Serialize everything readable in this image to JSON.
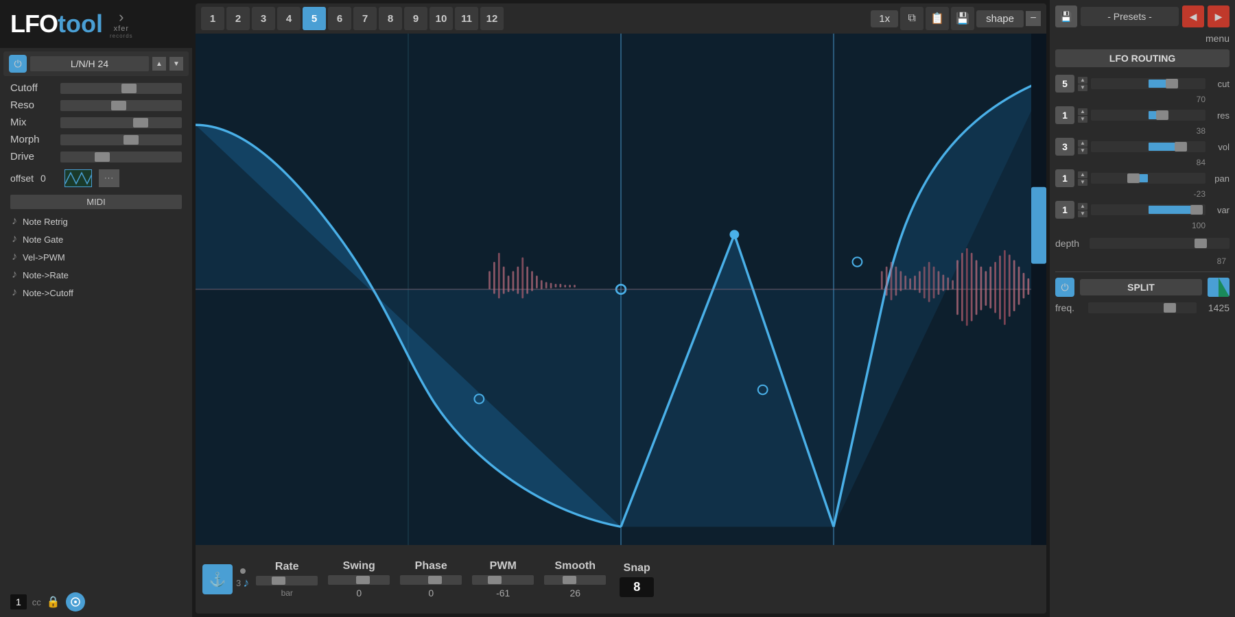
{
  "app": {
    "name_lfo": "LFO",
    "name_tool": "tool",
    "xfer_label": "xfer",
    "xfer_sub": "records"
  },
  "left_panel": {
    "filter_preset": "L/N/H 24",
    "power_icon": "⏻",
    "params": [
      {
        "label": "Cutoff",
        "thumb_pos": "55%"
      },
      {
        "label": "Reso",
        "thumb_pos": "48%"
      },
      {
        "label": "Mix",
        "thumb_pos": "65%"
      },
      {
        "label": "Morph",
        "thumb_pos": "58%"
      },
      {
        "label": "Drive",
        "thumb_pos": "35%"
      }
    ],
    "offset_label": "offset",
    "offset_value": "0",
    "midi_label": "MIDI",
    "midi_items": [
      "Note Retrig",
      "Note Gate",
      "Vel->PWM",
      "Note->Rate",
      "Note->Cutoff"
    ],
    "cc_value": "1",
    "cc_label": "cc"
  },
  "center_panel": {
    "tabs": [
      "1",
      "2",
      "3",
      "4",
      "5",
      "6",
      "7",
      "8",
      "9",
      "10",
      "11",
      "12"
    ],
    "active_tab": 5,
    "rate_display": "1x",
    "shape_label": "shape",
    "minus_label": "−",
    "bottom_bar": {
      "anchor_icon": "⚓",
      "beat_num": "3",
      "note_icon": "♪",
      "params": [
        {
          "label": "Rate",
          "value": "bar",
          "unit": "bar",
          "thumb_pos": "30%"
        },
        {
          "label": "Swing",
          "value": "0",
          "thumb_pos": "50%"
        },
        {
          "label": "Phase",
          "value": "0",
          "thumb_pos": "50%"
        },
        {
          "label": "PWM",
          "value": "-61",
          "thumb_pos": "30%"
        },
        {
          "label": "Smooth 26",
          "value": "26",
          "thumb_pos": "35%"
        }
      ],
      "snap_label": "Snap",
      "snap_value": "8"
    }
  },
  "right_panel": {
    "presets_label": "- Presets -",
    "prev_icon": "◀",
    "next_icon": "▶",
    "save_icon": "💾",
    "menu_label": "menu",
    "lfo_routing_title": "LFO ROUTING",
    "routing_rows": [
      {
        "num": "5",
        "label": "cut",
        "value": "70",
        "thumb_pos": "68%",
        "fill_width": "18%",
        "fill_left": "50%"
      },
      {
        "num": "1",
        "label": "res",
        "value": "38",
        "thumb_pos": "60%",
        "fill_width": "10%",
        "fill_left": "50%"
      },
      {
        "num": "3",
        "label": "vol",
        "value": "84",
        "thumb_pos": "76%",
        "fill_width": "26%",
        "fill_left": "50%"
      },
      {
        "num": "1",
        "label": "pan",
        "value": "-23",
        "thumb_pos": "38%",
        "fill_width": "12%",
        "fill_left": "38%"
      },
      {
        "num": "1",
        "label": "var",
        "value": "100",
        "thumb_pos": "90%",
        "fill_width": "40%",
        "fill_left": "50%"
      }
    ],
    "depth_label": "depth",
    "depth_value": "87",
    "depth_thumb": "80%",
    "split_label": "SPLIT",
    "split_power_icon": "⏻",
    "freq_label": "freq.",
    "freq_value": "1425",
    "freq_thumb_right": "25px"
  }
}
